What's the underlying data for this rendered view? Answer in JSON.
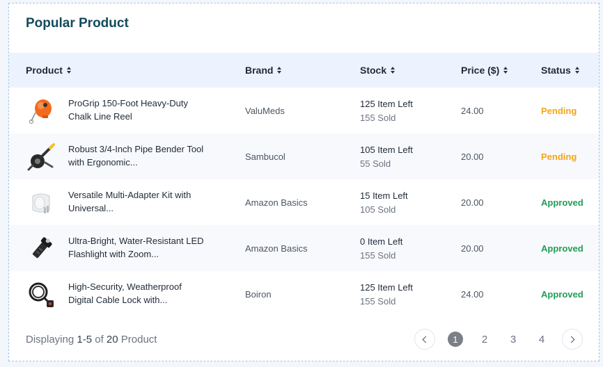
{
  "card": {
    "title": "Popular Product"
  },
  "table": {
    "columns": [
      {
        "label": "Product"
      },
      {
        "label": "Brand"
      },
      {
        "label": "Stock"
      },
      {
        "label": "Price ($)"
      },
      {
        "label": "Status"
      }
    ],
    "rows": [
      {
        "product_line1": "ProGrip 150-Foot Heavy-Duty",
        "product_line2": "Chalk Line Reel",
        "image_icon": "chalk-line-reel-icon",
        "brand": "ValuMeds",
        "stock_left": "125 Item Left",
        "sold": "155 Sold",
        "price": "24.00",
        "status": "Pending"
      },
      {
        "product_line1": "Robust 3/4-Inch Pipe Bender Tool",
        "product_line2": "with Ergonomic...",
        "image_icon": "pipe-bender-icon",
        "brand": "Sambucol",
        "stock_left": "105 Item Left",
        "sold": "55 Sold",
        "price": "20.00",
        "status": "Pending"
      },
      {
        "product_line1": "Versatile Multi-Adapter Kit with",
        "product_line2": "Universal...",
        "image_icon": "adapter-plug-icon",
        "brand": "Amazon Basics",
        "stock_left": "15 Item Left",
        "sold": "105 Sold",
        "price": "20.00",
        "status": "Approved"
      },
      {
        "product_line1": "Ultra-Bright, Water-Resistant LED",
        "product_line2": "Flashlight with Zoom...",
        "image_icon": "flashlight-icon",
        "brand": "Amazon Basics",
        "stock_left": "0 Item Left",
        "sold": "155 Sold",
        "price": "20.00",
        "status": "Approved"
      },
      {
        "product_line1": "High-Security, Weatherproof",
        "product_line2": "Digital Cable Lock with...",
        "image_icon": "cable-lock-icon",
        "brand": "Boiron",
        "stock_left": "125 Item Left",
        "sold": "155 Sold",
        "price": "24.00",
        "status": "Approved"
      }
    ]
  },
  "colors": {
    "pending": "#f2a51a",
    "approved": "#1f9d55",
    "title": "#134a5c",
    "header_bg": "#edf3fe",
    "pager_active": "#7b7f86"
  },
  "footer": {
    "prefix": "Displaying",
    "range": "1-5",
    "of_label": "of",
    "total": "20",
    "suffix": "Product"
  },
  "pagination": {
    "prev_icon": "chevron-left-icon",
    "next_icon": "chevron-right-icon",
    "pages": [
      "1",
      "2",
      "3",
      "4"
    ],
    "current": "1"
  }
}
